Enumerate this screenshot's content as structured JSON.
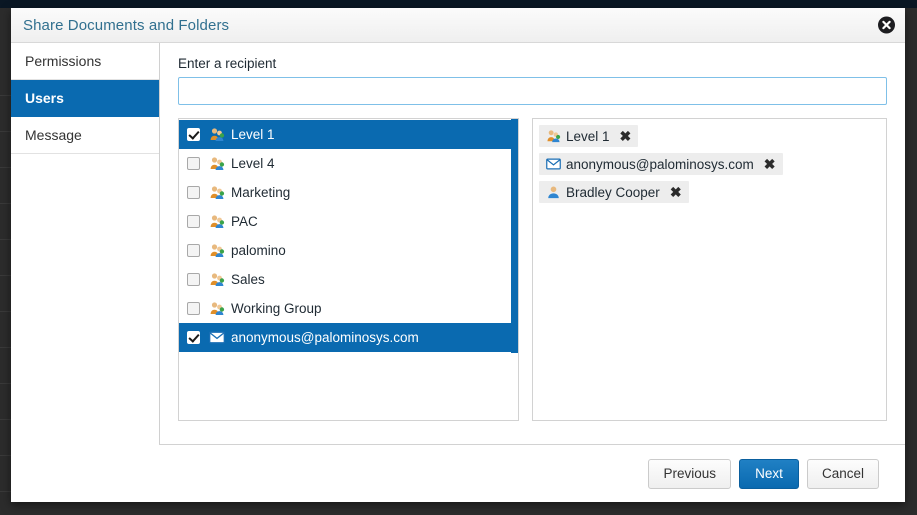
{
  "window": {
    "title": "Share Documents and Folders",
    "close_icon": "close-circle-icon"
  },
  "colors": {
    "accent": "#0a6ab0",
    "title_text": "#31708f",
    "chip_bg": "#ededed",
    "backdrop": "#2c2c2c"
  },
  "sidebar": {
    "items": [
      {
        "label": "Permissions",
        "active": false
      },
      {
        "label": "Users",
        "active": true
      },
      {
        "label": "Message",
        "active": false
      }
    ]
  },
  "main": {
    "field_label": "Enter a recipient",
    "recipient_input": {
      "value": "",
      "placeholder": ""
    },
    "available_list": [
      {
        "label": "Level 1",
        "icon": "group-icon",
        "checked": true,
        "selected": true
      },
      {
        "label": "Level 4",
        "icon": "group-icon",
        "checked": false,
        "selected": false
      },
      {
        "label": "Marketing",
        "icon": "group-icon",
        "checked": false,
        "selected": false
      },
      {
        "label": "PAC",
        "icon": "group-icon",
        "checked": false,
        "selected": false
      },
      {
        "label": "palomino",
        "icon": "group-icon",
        "checked": false,
        "selected": false
      },
      {
        "label": "Sales",
        "icon": "group-icon",
        "checked": false,
        "selected": false
      },
      {
        "label": "Working Group",
        "icon": "group-icon",
        "checked": false,
        "selected": false
      },
      {
        "label": "anonymous@palominosys.com",
        "icon": "envelope-icon",
        "checked": true,
        "selected": true
      }
    ],
    "selected_chips": [
      {
        "label": "Level 1",
        "icon": "group-icon",
        "remove": "✖"
      },
      {
        "label": "anonymous@palominosys.com",
        "icon": "envelope-icon",
        "remove": "✖"
      },
      {
        "label": "Bradley Cooper",
        "icon": "user-icon",
        "remove": "✖"
      }
    ]
  },
  "footer": {
    "previous_label": "Previous",
    "next_label": "Next",
    "cancel_label": "Cancel"
  }
}
